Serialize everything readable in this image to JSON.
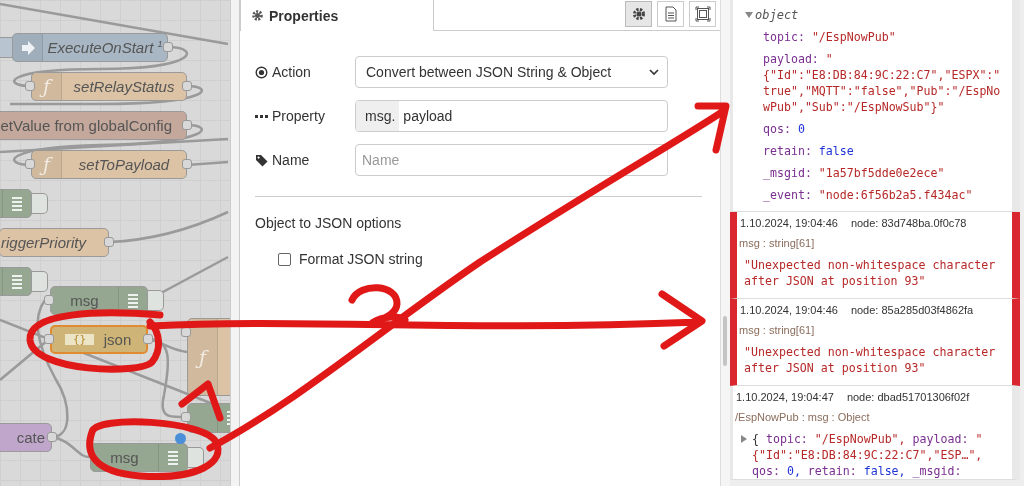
{
  "canvas": {
    "nodes": [
      {
        "kind": "inject",
        "label": "ExecuteOnStart $^{1}$",
        "italic": true,
        "selected": false,
        "changed": false
      },
      {
        "kind": "function",
        "icon": "ƒ",
        "label": "setRelayStatus",
        "italic": true,
        "selected": false,
        "changed": false
      },
      {
        "kind": "change",
        "label": "etValue from globalConfig",
        "italic": false,
        "selected": false,
        "changed": false
      },
      {
        "kind": "function",
        "icon": "ƒ",
        "label": "setToPayload",
        "italic": true,
        "selected": false,
        "changed": false
      },
      {
        "kind": "debug",
        "selected": false,
        "changed": false
      },
      {
        "kind": "function",
        "label": "riggerPriority",
        "italic": true,
        "selected": false,
        "changed": false
      },
      {
        "kind": "debug",
        "selected": false,
        "changed": false
      },
      {
        "kind": "debug",
        "label": "msg",
        "italic": false,
        "selected": false,
        "changed": false
      },
      {
        "kind": "json",
        "icon": "{}",
        "label": "json",
        "italic": false,
        "selected": true,
        "changed": false
      },
      {
        "kind": "function",
        "icon": "ƒ",
        "selected": false,
        "changed": false
      },
      {
        "kind": "debug",
        "selected": false,
        "changed": false
      },
      {
        "kind": "link",
        "label": "cate",
        "italic": false,
        "selected": false,
        "changed": false
      },
      {
        "kind": "debug",
        "label": "msg",
        "italic": false,
        "selected": false,
        "changed": true
      }
    ]
  },
  "editor": {
    "tabs": [
      {
        "label": "Properties",
        "selected": true
      }
    ],
    "toolbar": [
      {
        "kind": "settings",
        "selected": true
      },
      {
        "kind": "description",
        "selected": false
      },
      {
        "kind": "appearance",
        "selected": false
      }
    ],
    "fields": [
      {
        "kind": "select",
        "label": "Action",
        "value": "Convert between JSON String & Object"
      },
      {
        "kind": "typed",
        "label": "Property",
        "prefix": "msg.",
        "value": "payload"
      },
      {
        "kind": "text",
        "label": "Name",
        "placeholder": "Name"
      }
    ],
    "section_title": "Object to JSON options",
    "options": [
      {
        "label": "Format JSON string",
        "checked": false
      }
    ]
  },
  "debug": {
    "object": {
      "label": "object",
      "expanded": true,
      "properties": [
        {
          "key": "topic:",
          "value": "\"/EspNowPub\"",
          "kind": "string"
        },
        {
          "key": "payload:",
          "value": "\"{\"Id\":\"E8:DB:84:9C:22:C7\",\"ESPX\":\"true\",\"MQTT\":\"false\",\"Pub\":\"/EspNowPub\",\"Sub\":\"/EspNowSub\"}\"",
          "kind": "string"
        },
        {
          "key": "qos:",
          "value": "0",
          "kind": "number"
        },
        {
          "key": "retain:",
          "value": "false",
          "kind": "boolean"
        },
        {
          "key": "_msgid:",
          "value": "\"1a57bf5dde0e2ece\"",
          "kind": "string"
        },
        {
          "key": "_event:",
          "value": "\"node:6f56b2a5.f434ac\"",
          "kind": "string"
        }
      ]
    },
    "messages": [
      {
        "error": true,
        "timestamp": "1.10.2024, 19:04:46",
        "node": "node: 83d748ba.0f0c78",
        "meta": "msg : string[61]",
        "body": "\"Unexpected non-whitespace character after JSON at position 93\""
      },
      {
        "error": true,
        "timestamp": "1.10.2024, 19:04:46",
        "node": "node: 85a285d03f4862fa",
        "meta": "msg : string[61]",
        "body": "\"Unexpected non-whitespace character after JSON at position 93\""
      },
      {
        "error": false,
        "timestamp": "1.10.2024, 19:04:47",
        "node": "node: dbad51701306f02f",
        "meta": "/EspNowPub : msg : Object",
        "expanded": false,
        "open": "{",
        "preview": [
          {
            "key": "topic:",
            "value": "\"/EspNowPub\",",
            "kind": "string"
          },
          {
            "key": "payload:",
            "value": "\"{\"Id\":\"E8:DB:84:9C:22:C7\",\"ESP…\",",
            "kind": "string"
          },
          {
            "key": "qos:",
            "value": "0,",
            "kind": "number"
          },
          {
            "key": "retain:",
            "value": "false,",
            "kind": "boolean"
          },
          {
            "key": "_msgid:"
          }
        ]
      }
    ]
  }
}
